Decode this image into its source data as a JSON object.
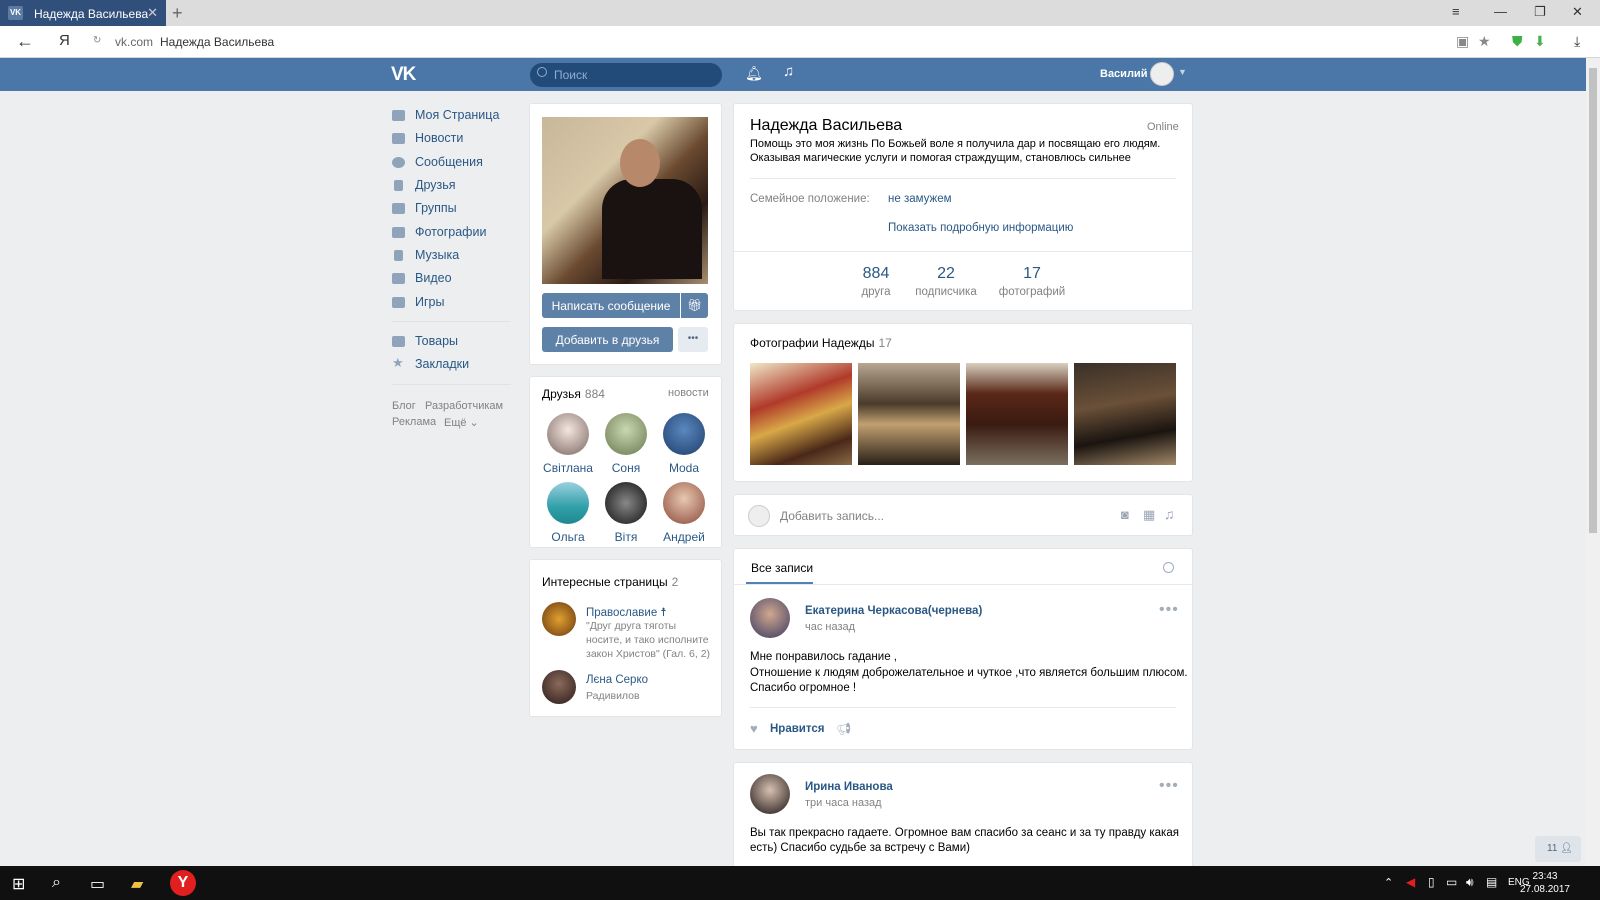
{
  "browser": {
    "tab_title": "Надежда Васильева",
    "tab_icon": "VK",
    "new_tab": "+",
    "address_domain": "vk.com",
    "address_title": "Надежда Васильева",
    "yandex_logo": "Я"
  },
  "header": {
    "logo": "VK",
    "search_placeholder": "Поиск",
    "user_name": "Василий"
  },
  "menu": {
    "items": [
      "Моя Страница",
      "Новости",
      "Сообщения",
      "Друзья",
      "Группы",
      "Фотографии",
      "Музыка",
      "Видео",
      "Игры"
    ],
    "extra": [
      "Товары",
      "Закладки"
    ],
    "footer": [
      "Блог",
      "Разработчикам",
      "Реклама",
      "Ещё ⌄"
    ]
  },
  "profile": {
    "name": "Надежда Васильева",
    "status_online": "Online",
    "status_line1": "Помощь это моя жизнь По Божьей воле я получила дар и посвящаю его людям.",
    "status_line2": "Оказывая магические услуги и помогая страждущим, становлюсь сильнее",
    "family_label": "Семейное положение:",
    "family_value": "не замужем",
    "show_more": "Показать подробную информацию",
    "stats": [
      {
        "value": "884",
        "label": "друга"
      },
      {
        "value": "22",
        "label": "подписчика"
      },
      {
        "value": "17",
        "label": "фотографий"
      }
    ],
    "send_message": "Написать сообщение",
    "add_friend": "Добавить в друзья",
    "more": "•••"
  },
  "friends": {
    "title": "Друзья",
    "count": "884",
    "news_link": "новости",
    "list": [
      "Світлана",
      "Соня",
      "Moda",
      "Ольга",
      "Вітя",
      "Андрей"
    ]
  },
  "interesting": {
    "title": "Интересные страницы",
    "count": "2",
    "pages": [
      {
        "name": "Православие ☨",
        "desc1": "\"Друг друга тяготы",
        "desc2": "носите, и тако исполните",
        "desc3": "закон Христов\" (Гал. 6, 2)"
      },
      {
        "name": "Лєна Серко",
        "desc1": "Радивилов"
      }
    ]
  },
  "photos": {
    "title": "Фотографии Надежды",
    "count": "17"
  },
  "composer": {
    "placeholder": "Добавить запись..."
  },
  "wall": {
    "tab_all": "Все записи",
    "posts": [
      {
        "author": "Екатерина Черкасова(чернева)",
        "time": "час назад",
        "lines": [
          "Мне понравилось гадание ,",
          "Отношение к людям доброжелательное и чуткое ,что является большим плюсом.",
          "Спасибо огромное !"
        ],
        "like_label": "Нравится"
      },
      {
        "author": "Ирина Иванова",
        "time": "три часа назад",
        "lines": [
          "Вы так прекрасно гадаете. Огромное вам спасибо за сеанс и за ту правду какая",
          "есть) Спасибо судьбе за встречу с Вами)"
        ]
      }
    ]
  },
  "messages_badge": "11",
  "taskbar": {
    "lang": "ENG",
    "time": "23:43",
    "date": "27.08.2017"
  },
  "colors": {
    "vk_blue": "#4a76a8",
    "link": "#2a5885",
    "button": "#5e81a8",
    "page_bg": "#edeef0"
  }
}
